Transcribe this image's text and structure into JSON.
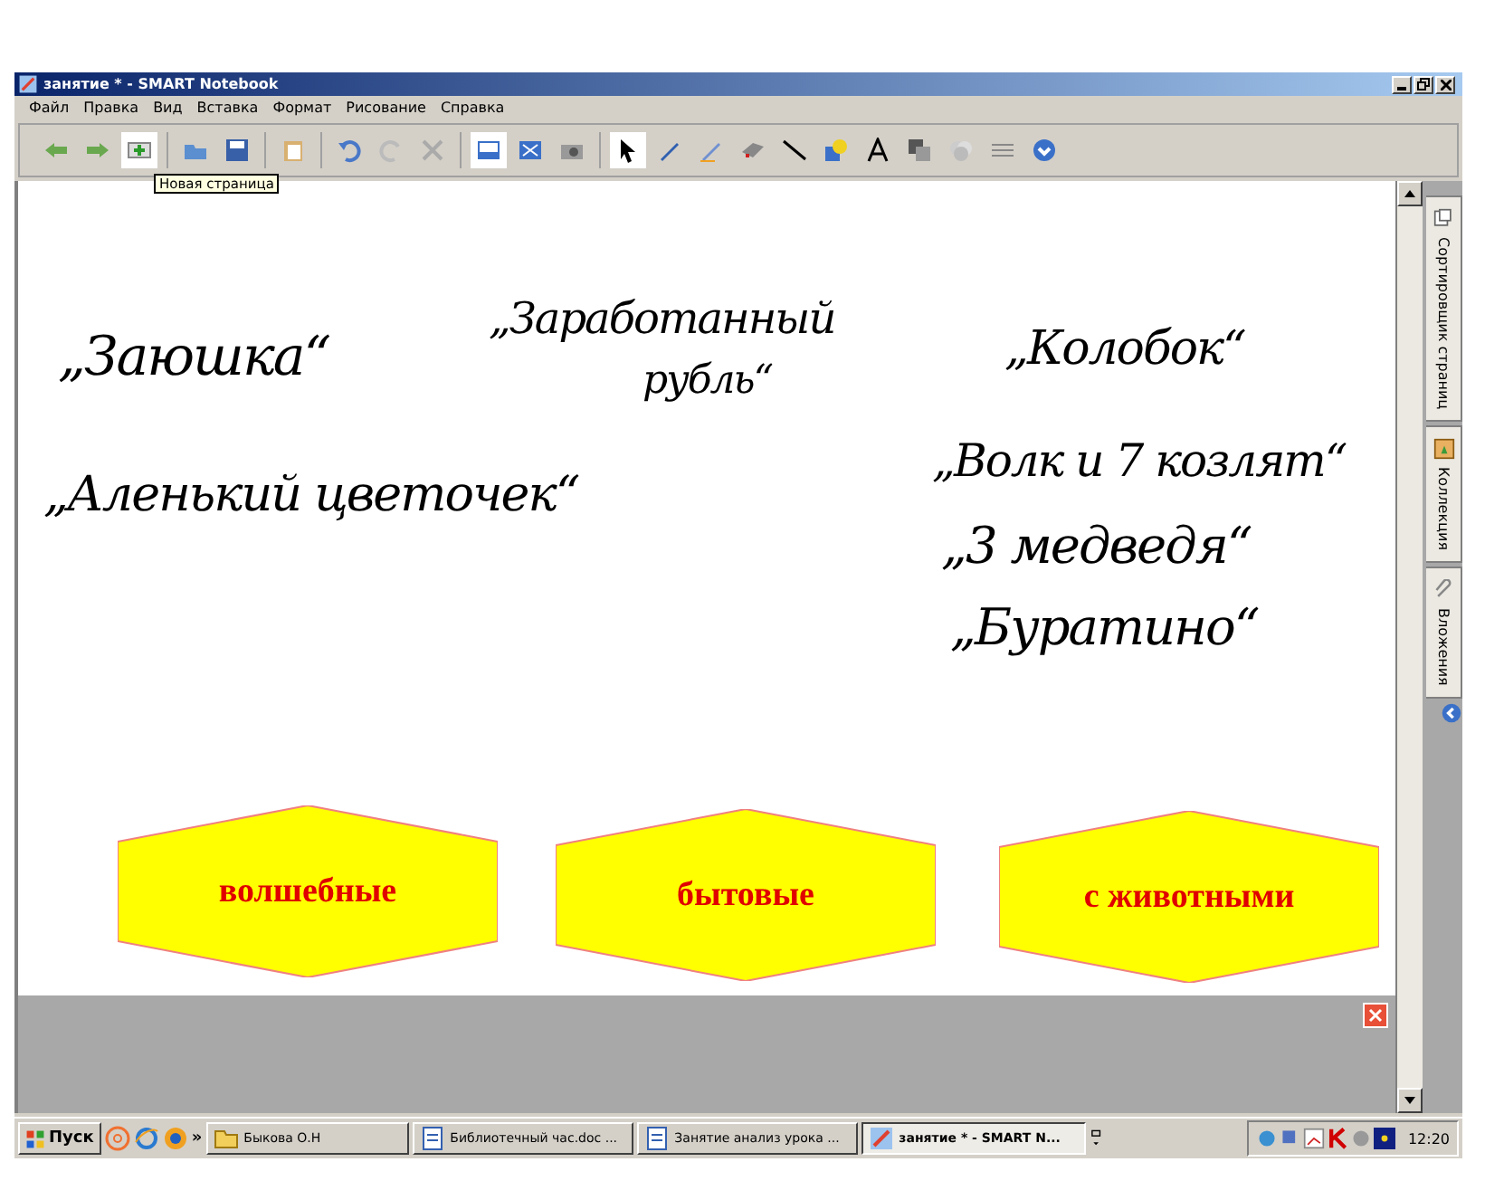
{
  "window": {
    "title": "занятие * - SMART Notebook"
  },
  "menu": [
    "Файл",
    "Правка",
    "Вид",
    "Вставка",
    "Формат",
    "Рисование",
    "Справка"
  ],
  "tooltip": "Новая страница",
  "ink": [
    {
      "text": "„Заюшка“",
      "kind": "single"
    },
    {
      "text": "„Заработанный",
      "kind": "single"
    },
    {
      "text": "рубль“",
      "kind": "single"
    },
    {
      "text": "„Аленький цветочек“",
      "kind": "single"
    },
    {
      "text": "„Колобок“",
      "kind": "single"
    },
    {
      "text": "„Волк и 7 козлят“",
      "kind": "single"
    },
    {
      "text": "„3 медведя“",
      "kind": "single"
    },
    {
      "text": "„Буратино“",
      "kind": "single"
    }
  ],
  "categories": [
    {
      "label": "волшебные"
    },
    {
      "label": "бытовые"
    },
    {
      "label": "с животными"
    }
  ],
  "side_tabs": [
    {
      "label": "Сортировщик страниц",
      "kind": "sorter"
    },
    {
      "label": "Коллекция",
      "kind": "gallery"
    },
    {
      "label": "Вложения",
      "kind": "attach"
    }
  ],
  "taskbar": {
    "start": "Пуск",
    "more": "»",
    "tasks": [
      {
        "label": "Быкова О.Н",
        "kind": "folder",
        "selected": false
      },
      {
        "label": "Библиотечный час.doc ...",
        "kind": "doc",
        "selected": false
      },
      {
        "label": "Занятие анализ урока ...",
        "kind": "doc",
        "selected": false
      },
      {
        "label": "занятие * - SMART N...",
        "kind": "app",
        "selected": true
      }
    ],
    "clock": "12:20"
  }
}
